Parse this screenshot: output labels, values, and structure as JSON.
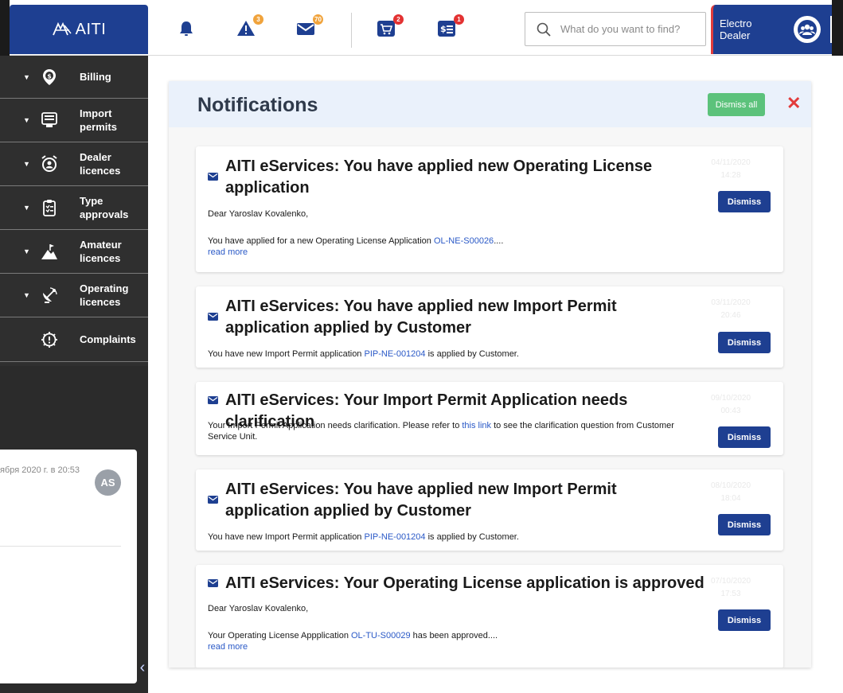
{
  "brand": {
    "logo_text": "AITI"
  },
  "topbar": {
    "alerts_badge": "3",
    "messages_badge": "70",
    "cart_badge": "2",
    "payments_badge": "1",
    "search_placeholder": "What do you want to find?",
    "user_name": "Electro Dealer"
  },
  "sidebar": {
    "items": [
      {
        "label": "Billing",
        "icon": "billing-icon"
      },
      {
        "label": "Import permits",
        "icon": "import-permits-icon"
      },
      {
        "label": "Dealer licences",
        "icon": "dealer-licences-icon"
      },
      {
        "label": "Type approvals",
        "icon": "type-approvals-icon"
      },
      {
        "label": "Amateur licences",
        "icon": "amateur-licences-icon"
      },
      {
        "label": "Operating licences",
        "icon": "operating-licences-icon"
      },
      {
        "label": "Complaints",
        "icon": "complaints-icon"
      }
    ]
  },
  "chat": {
    "time": "ября 2020 г. в 20:53",
    "avatar": "AS"
  },
  "notifications": {
    "title": "Notifications",
    "dismiss_all": "Dismiss all",
    "items": [
      {
        "title": "AITI eServices: You have applied new Operating License application",
        "date": "04/11/2020",
        "time": "14:28",
        "line1": "Dear Yaroslav Kovalenko,",
        "line2_prefix": "You have applied for a new Operating License Application ",
        "link": "OL-NE-S00026",
        "line2_suffix": "....",
        "read_more": "read more",
        "dismiss": "Dismiss"
      },
      {
        "title": "AITI eServices: You have applied new Import Permit application applied by Customer",
        "date": "03/11/2020",
        "time": "20:46",
        "line1_prefix": "You have new Import Permit application ",
        "link": "PIP-NE-001204",
        "line1_suffix": " is applied by Customer.",
        "dismiss": "Dismiss"
      },
      {
        "title": "AITI eServices: Your Import Permit Application needs clarification",
        "date": "09/10/2020",
        "time": "00:43",
        "line1_prefix": "Your Import Permit Application needs clarification. Please refer to ",
        "link": "this link",
        "line1_suffix": " to see the clarification question from Customer Service Unit.",
        "dismiss": "Dismiss"
      },
      {
        "title": "AITI eServices: You have applied new Import Permit application applied by Customer",
        "date": "08/10/2020",
        "time": "18:04",
        "line1_prefix": "You have new Import Permit application ",
        "link": "PIP-NE-001204",
        "line1_suffix": " is applied by Customer.",
        "dismiss": "Dismiss"
      },
      {
        "title": "AITI eServices: Your Operating License application is approved",
        "date": "07/10/2020",
        "time": "17:53",
        "line1": "Dear Yaroslav Kovalenko,",
        "line2_prefix": "Your Operating License Appplication ",
        "link": "OL-TU-S00029",
        "line2_suffix": " has been approved....",
        "read_more": "read more",
        "dismiss": "Dismiss"
      }
    ]
  },
  "colors": {
    "brand_blue": "#1e3f91",
    "dismiss_all_green": "#5cc27b",
    "close_red": "#e23b3b",
    "link_blue": "#2a59c7",
    "sidebar_dark": "#2f2f2f"
  }
}
